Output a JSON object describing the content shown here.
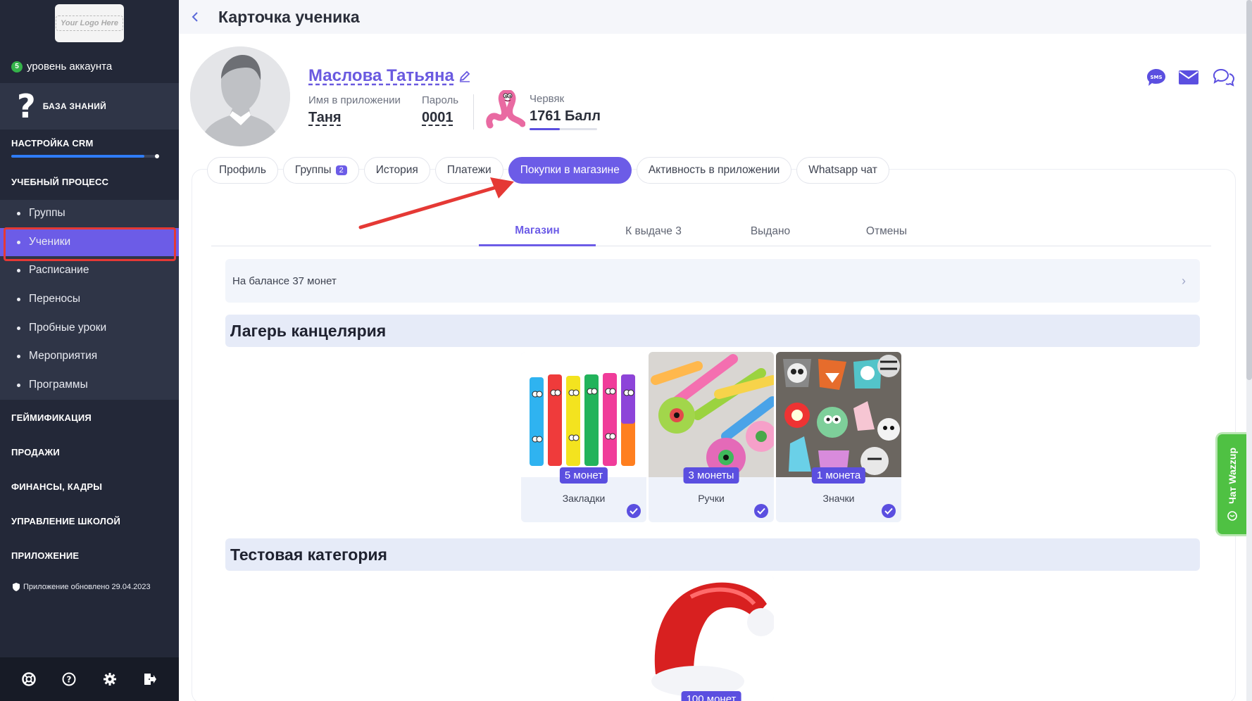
{
  "sidebar": {
    "logo_text": "Your Logo Here",
    "account_level_badge": "5",
    "account_level_label": "уровень аккаунта",
    "knowledge_label": "БАЗА ЗНАНИЙ",
    "crm_setup_label": "НАСТРОЙКА CRM",
    "crm_setup_progress": 0.9,
    "process_label": "УЧЕБНЫЙ ПРОЦЕСС",
    "process_items": [
      {
        "label": "Группы"
      },
      {
        "label": "Ученики"
      },
      {
        "label": "Расписание"
      },
      {
        "label": "Переносы"
      },
      {
        "label": "Пробные уроки"
      },
      {
        "label": "Мероприятия"
      },
      {
        "label": "Программы"
      }
    ],
    "sections": [
      {
        "label": "ГЕЙМИФИКАЦИЯ"
      },
      {
        "label": "ПРОДАЖИ"
      },
      {
        "label": "ФИНАНСЫ, КАДРЫ"
      },
      {
        "label": "УПРАВЛЕНИЕ ШКОЛОЙ"
      },
      {
        "label": "ПРИЛОЖЕНИЕ"
      }
    ],
    "update_note": "Приложение обновлено 29.04.2023",
    "footer_icons": [
      "support-icon",
      "help-icon",
      "settings-icon",
      "logout-icon"
    ]
  },
  "header": {
    "title": "Карточка ученика"
  },
  "student": {
    "name": "Маслова Татьяна",
    "app_name_label": "Имя в приложении",
    "app_name_value": "Таня",
    "password_label": "Пароль",
    "password_value": "0001",
    "rank_label": "Червяк",
    "rank_points": "1761 Балл",
    "rank_progress": 0.45
  },
  "tabs": [
    {
      "label": "Профиль",
      "active": false
    },
    {
      "label": "Группы",
      "badge": "2",
      "active": false
    },
    {
      "label": "История",
      "active": false
    },
    {
      "label": "Платежи",
      "active": false
    },
    {
      "label": "Покупки в магазине",
      "active": true
    },
    {
      "label": "Активность в приложении",
      "active": false
    },
    {
      "label": "Whatsapp чат",
      "active": false
    }
  ],
  "subtabs": [
    {
      "label": "Магазин",
      "active": true
    },
    {
      "label": "К выдаче 3",
      "active": false
    },
    {
      "label": "Выдано",
      "active": false
    },
    {
      "label": "Отмены",
      "active": false
    }
  ],
  "balance_text": "На балансе 37 монет",
  "categories": [
    {
      "title": "Лагерь канцелярия",
      "products": [
        {
          "name": "Закладки",
          "price": "5 монет"
        },
        {
          "name": "Ручки",
          "price": "3 монеты"
        },
        {
          "name": "Значки",
          "price": "1 монета"
        }
      ]
    },
    {
      "title": "Тестовая категория",
      "products": [
        {
          "name": "",
          "price": "100 монет"
        }
      ]
    }
  ],
  "wazzup_label": "Чат Wazzup",
  "colors": {
    "accent": "#6c5ce7",
    "sidebar_bg": "#232838",
    "sidebar_active": "#6c5ce7",
    "annotation_red": "#e53935",
    "wazzup_green": "#4fc143"
  }
}
